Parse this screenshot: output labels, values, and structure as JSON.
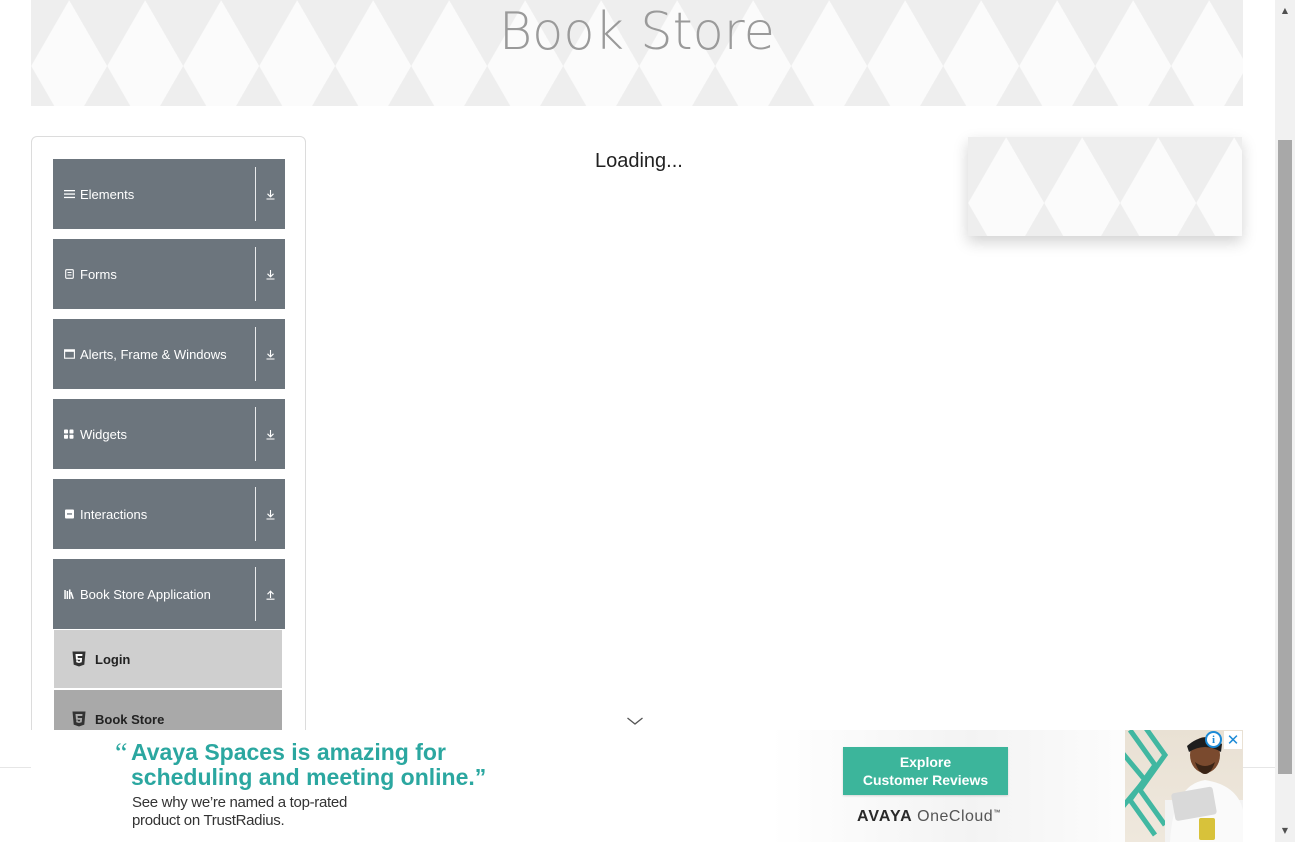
{
  "header": {
    "title": "Book Store"
  },
  "main": {
    "loading_text": "Loading..."
  },
  "sidebar": {
    "groups": [
      {
        "label": "Elements",
        "icon": "menu-icon",
        "toggle_icon": "download-arrow-icon"
      },
      {
        "label": "Forms",
        "icon": "form-icon",
        "toggle_icon": "download-arrow-icon"
      },
      {
        "label": "Alerts, Frame & Windows",
        "icon": "window-icon",
        "toggle_icon": "download-arrow-icon"
      },
      {
        "label": "Widgets",
        "icon": "widgets-icon",
        "toggle_icon": "download-arrow-icon"
      },
      {
        "label": "Interactions",
        "icon": "interactions-icon",
        "toggle_icon": "download-arrow-icon"
      },
      {
        "label": "Book Store Application",
        "icon": "books-icon",
        "toggle_icon": "upload-arrow-icon"
      }
    ],
    "sub_items": [
      {
        "label": "Login",
        "icon": "html5-icon",
        "state": "default"
      },
      {
        "label": "Book Store",
        "icon": "html5-icon",
        "state": "active"
      }
    ]
  },
  "ad": {
    "quote_line1": "Avaya Spaces is amazing for",
    "quote_line2": "scheduling and meeting online.”",
    "quote_open": "“",
    "sub_line1": "See why we’re named a top-rated",
    "sub_line2": "product on TrustRadius.",
    "cta_line1": "Explore",
    "cta_line2": "Customer Reviews",
    "brand_part1": "AVAYA",
    "brand_part2": "OneCloud",
    "brand_mark": "™",
    "info_label": "i",
    "close_label": "✕",
    "accent_color": "#2ba7a0",
    "cta_color": "#3cb59b"
  },
  "colors": {
    "group_header_bg": "#6c757d",
    "sub_item_default_bg": "#cfcfcf",
    "sub_item_active_bg": "#a9a9a9",
    "title_color": "#9a9a9a"
  }
}
